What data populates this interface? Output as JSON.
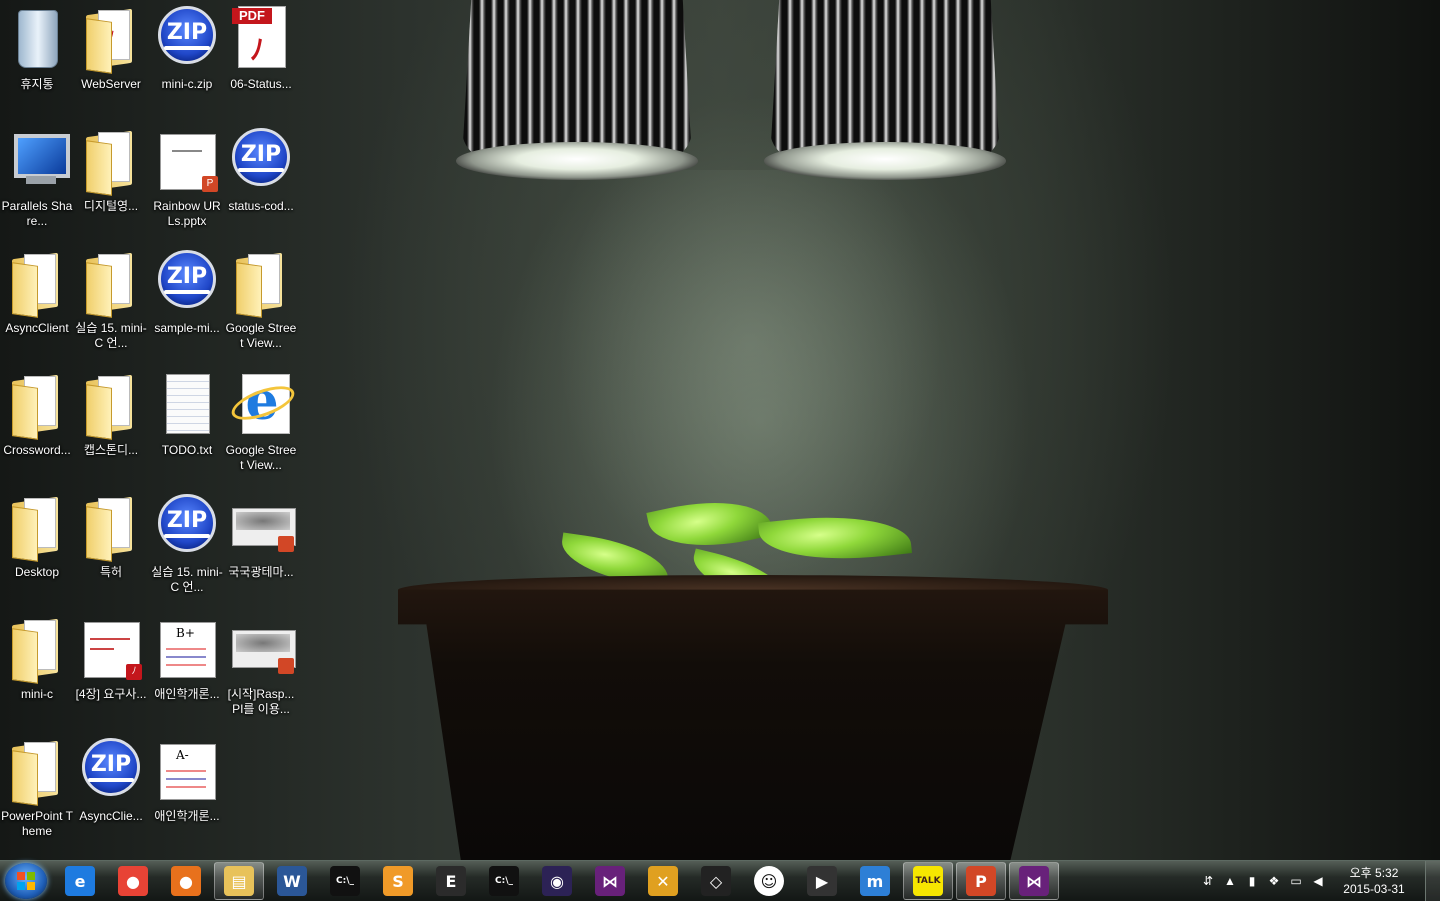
{
  "desktop_icons": [
    {
      "label": "휴지통",
      "kind": "recycle"
    },
    {
      "label": "WebServer",
      "kind": "folder-pdf"
    },
    {
      "label": "mini-c.zip",
      "kind": "zip"
    },
    {
      "label": "06-Status...",
      "kind": "pdf"
    },
    {
      "label": "Parallels Share...",
      "kind": "monitor"
    },
    {
      "label": "디지털영...",
      "kind": "folder"
    },
    {
      "label": "Rainbow URLs.pptx",
      "kind": "pptx"
    },
    {
      "label": "status-cod...",
      "kind": "zip"
    },
    {
      "label": "AsyncClient",
      "kind": "folder"
    },
    {
      "label": "실습 15. mini-C 언...",
      "kind": "folder"
    },
    {
      "label": "sample-mi...",
      "kind": "zip"
    },
    {
      "label": "Google Street View...",
      "kind": "folder"
    },
    {
      "label": "Crossword...",
      "kind": "folder"
    },
    {
      "label": "캡스톤디...",
      "kind": "folder"
    },
    {
      "label": "TODO.txt",
      "kind": "txt"
    },
    {
      "label": "Google Street View...",
      "kind": "ie"
    },
    {
      "label": "Desktop",
      "kind": "folder"
    },
    {
      "label": "특허",
      "kind": "folder"
    },
    {
      "label": "실습 15. mini-C 언...",
      "kind": "zip"
    },
    {
      "label": "국국광테마...",
      "kind": "pptx-map"
    },
    {
      "label": "mini-c",
      "kind": "folder"
    },
    {
      "label": "[4장] 요구사...",
      "kind": "pdf-doc"
    },
    {
      "label": "애인학개론...",
      "kind": "grade-doc"
    },
    {
      "label": "[시작]Rasp... PI를 이용...",
      "kind": "pptx-map"
    },
    {
      "label": "PowerPoint Theme",
      "kind": "folder"
    },
    {
      "label": "AsyncClie...",
      "kind": "zip"
    },
    {
      "label": "애인학개론...",
      "kind": "grade-doc"
    }
  ],
  "grade_labels": [
    "B+",
    "A-"
  ],
  "pdf_tag": "PDF",
  "zip_text": "ZIP",
  "taskbar": {
    "pinned": [
      {
        "name": "internet-explorer",
        "glyph": "e",
        "color": "#1e7be0"
      },
      {
        "name": "chrome",
        "glyph": "●",
        "color": "#e84335"
      },
      {
        "name": "firefox",
        "glyph": "●",
        "color": "#e8711c"
      },
      {
        "name": "file-explorer",
        "glyph": "▤",
        "color": "#e8c25a"
      },
      {
        "name": "word",
        "glyph": "W",
        "color": "#2b5797"
      },
      {
        "name": "command-prompt",
        "glyph": "C:\\_",
        "color": "#111111"
      },
      {
        "name": "sublime-text",
        "glyph": "S",
        "color": "#f09a28"
      },
      {
        "name": "console-editor",
        "glyph": "E",
        "color": "#2b2b2b"
      },
      {
        "name": "command-prompt-2",
        "glyph": "C:\\_",
        "color": "#111111"
      },
      {
        "name": "eclipse",
        "glyph": "◉",
        "color": "#2c2255"
      },
      {
        "name": "visual-studio",
        "glyph": "⋈",
        "color": "#68217a"
      },
      {
        "name": "chart-app",
        "glyph": "✕",
        "color": "#e0a020"
      },
      {
        "name": "unity",
        "glyph": "◇",
        "color": "#222222"
      },
      {
        "name": "smiley-app",
        "glyph": "☺",
        "color": "#ffffff"
      },
      {
        "name": "media-player",
        "glyph": "▶",
        "color": "#333333"
      },
      {
        "name": "messenger-m",
        "glyph": "m",
        "color": "#2d7fd6"
      },
      {
        "name": "kakaotalk",
        "glyph": "TALK",
        "color": "#f7e600"
      },
      {
        "name": "powerpoint",
        "glyph": "P",
        "color": "#d24726"
      },
      {
        "name": "visual-studio-2",
        "glyph": "⋈",
        "color": "#68217a"
      }
    ],
    "clock_ampm_time": "오후 5:32",
    "clock_date": "2015-03-31"
  }
}
